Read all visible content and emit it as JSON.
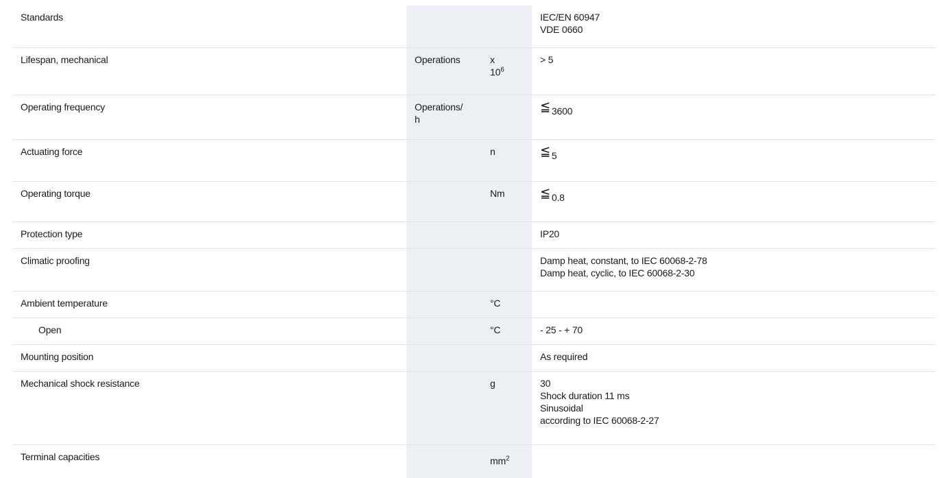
{
  "rows": [
    {
      "label": "Standards",
      "unit1": "",
      "unit2": "",
      "value_lines": [
        "IEC/EN 60947",
        "VDE 0660"
      ]
    },
    {
      "label": "Lifespan, mechanical",
      "unit1": "Operations",
      "unit2_line1": "x",
      "unit2_base": "10",
      "unit2_sup": "6",
      "value_lines": [
        "> 5"
      ]
    },
    {
      "label": "Operating frequency",
      "unit1_line1": "Operations/",
      "unit1_line2": "h",
      "unit2": "",
      "value_symbol": "≦",
      "value_num": "3600"
    },
    {
      "label": "Actuating force",
      "unit1": "",
      "unit2": "n",
      "value_symbol": "≦",
      "value_num": "5"
    },
    {
      "label": "Operating torque",
      "unit1": "",
      "unit2": "Nm",
      "value_symbol": "≦",
      "value_num": "0.8"
    },
    {
      "label": "Protection type",
      "unit1": "",
      "unit2": "",
      "value_lines": [
        "IP20"
      ]
    },
    {
      "label": "Climatic proofing",
      "unit1": "",
      "unit2": "",
      "value_lines": [
        "Damp heat, constant, to IEC 60068-2-78",
        "Damp heat, cyclic, to IEC 60068-2-30"
      ]
    },
    {
      "label": "Ambient temperature",
      "unit1": "",
      "unit2": "°C",
      "value_lines": []
    },
    {
      "label": "Open",
      "unit1": "",
      "unit2": "°C",
      "value_lines": [
        "- 25 - + 70"
      ]
    },
    {
      "label": "Mounting position",
      "unit1": "",
      "unit2": "",
      "value_lines": [
        "As required"
      ]
    },
    {
      "label": "Mechanical shock resistance",
      "unit1": "",
      "unit2": "g",
      "value_lines": [
        "30",
        "Shock duration 11 ms",
        "Sinusoidal",
        "according to IEC 60068-2-27"
      ]
    },
    {
      "label": "Terminal capacities",
      "unit1": "",
      "unit2_base": "mm",
      "unit2_sup": "2",
      "value_lines": []
    }
  ]
}
